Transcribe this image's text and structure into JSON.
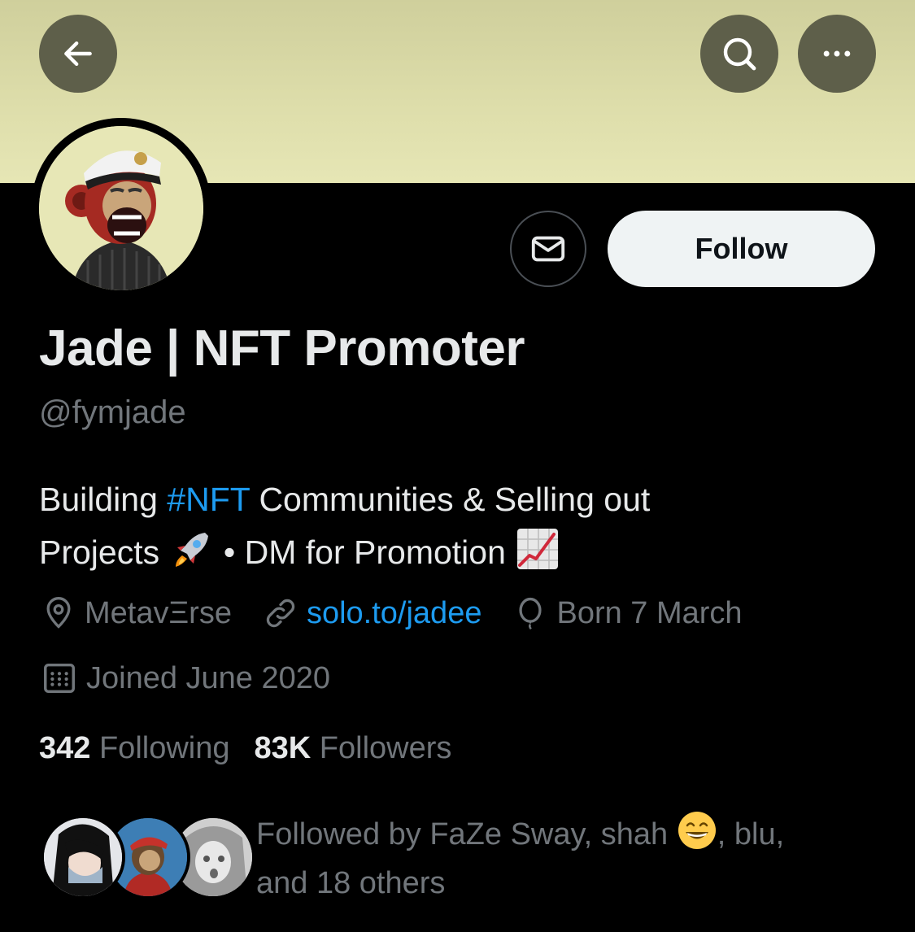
{
  "header": {
    "back_icon": "arrow-left-icon",
    "search_icon": "search-icon",
    "more_icon": "more-horizontal-icon",
    "banner_color": "#dedeab",
    "button_color": "#5e5f4a"
  },
  "profile": {
    "name": "Jade | NFT Promoter",
    "handle": "@fymjade",
    "bio": {
      "line1_a": "Building ",
      "hashtag": "#NFT",
      "line1_b": " Communities & Selling out",
      "line2_a": "Projects ",
      "line2_b": " • DM for Promotion "
    },
    "location": "MetavΞrse",
    "website": "solo.to/jadee",
    "birthday": "Born 7 March",
    "joined": "Joined June 2020"
  },
  "actions": {
    "follow_label": "Follow",
    "message_icon": "envelope-icon"
  },
  "stats": {
    "following_count": "342",
    "following_label": "Following",
    "followers_count": "83K",
    "followers_label": "Followers"
  },
  "followed_by": {
    "prefix": "Followed by FaZe Sway, shah ",
    "suffix": ", blu,",
    "line2": "and 18 others"
  },
  "colors": {
    "accent": "#1d9bf0",
    "secondary_text": "#71767b",
    "primary_text": "#e7e9ea"
  }
}
